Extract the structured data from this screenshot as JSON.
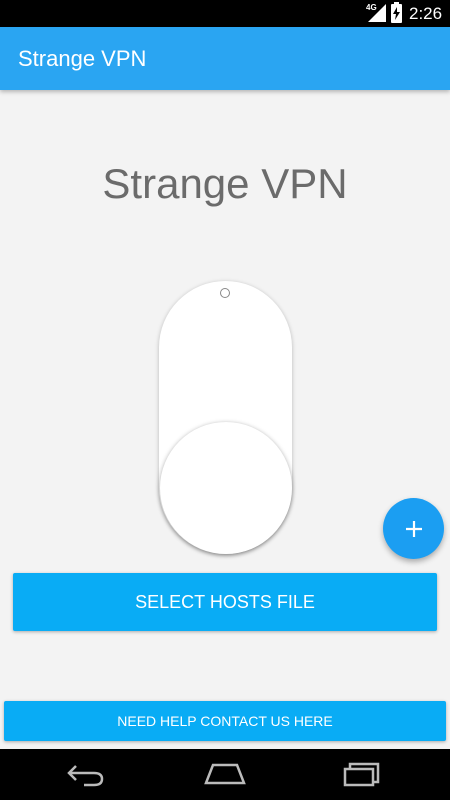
{
  "status_bar": {
    "network": "4G",
    "time": "2:26"
  },
  "app_bar": {
    "title": "Strange VPN"
  },
  "main": {
    "headline": "Strange VPN",
    "vpn_toggle": {
      "state": "off"
    },
    "select_hosts_button": "SELECT HOSTS FILE",
    "help_button": "NEED HELP CONTACT US HERE"
  },
  "fab": {
    "icon": "plus-icon"
  },
  "nav_bar": {
    "icons": [
      "back-icon",
      "home-icon",
      "recents-icon"
    ]
  },
  "colors": {
    "app_bar": "#2aa5f2",
    "button": "#09acf5",
    "fab": "#1b9ef2",
    "background": "#f3f3f3"
  }
}
